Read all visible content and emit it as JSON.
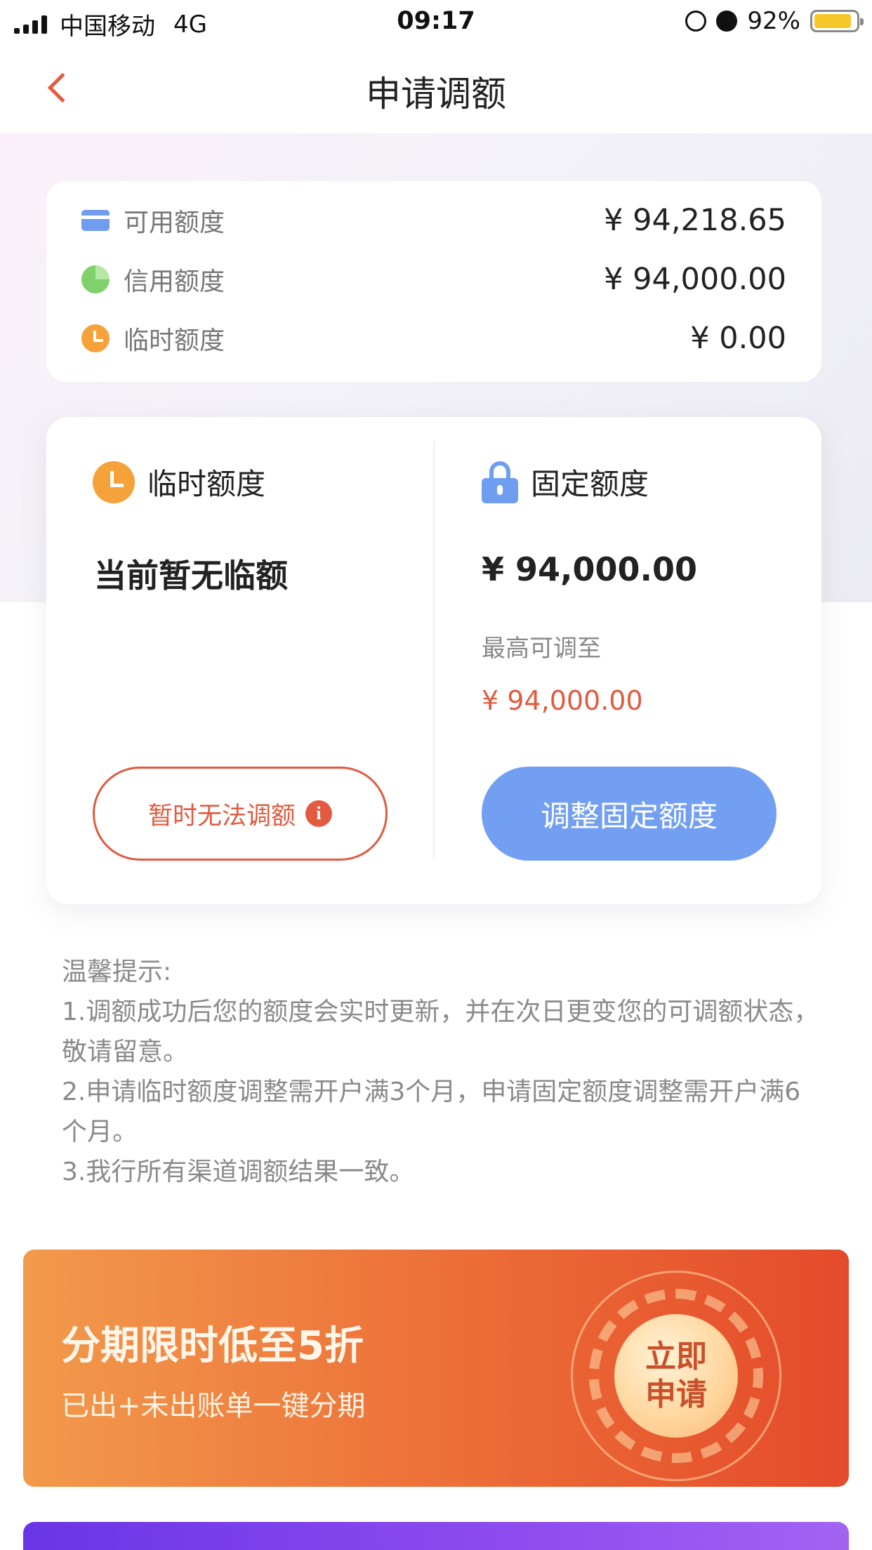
{
  "status_bar": {
    "carrier": "中国移动",
    "network": "4G",
    "time": "09:17",
    "battery": "92%"
  },
  "nav": {
    "title": "申请调额"
  },
  "summary": {
    "rows": [
      {
        "label": "可用额度",
        "value": "¥ 94,218.65",
        "icon": "card-icon"
      },
      {
        "label": "信用额度",
        "value": "¥ 94,000.00",
        "icon": "pie-icon"
      },
      {
        "label": "临时额度",
        "value": "¥ 0.00",
        "icon": "clock-icon"
      }
    ]
  },
  "temp_limit": {
    "title": "临时额度",
    "status": "当前暂无临额",
    "button_label": "暂时无法调额",
    "info_glyph": "i"
  },
  "fixed_limit": {
    "title": "固定额度",
    "value": "¥ 94,000.00",
    "max_label": "最高可调至",
    "max_value": "¥ 94,000.00",
    "button_label": "调整固定额度"
  },
  "tips": {
    "heading": "温馨提示:",
    "items": [
      "1.调额成功后您的额度会实时更新，并在次日更变您的可调额状态，敬请留意。",
      "2.申请临时额度调整需开户满3个月，申请固定额度调整需开户满6个月。",
      "3.我行所有渠道调额结果一致。"
    ]
  },
  "banner": {
    "title": "分期限时低至5折",
    "subtitle": "已出+未出账单一键分期",
    "badge_line1": "立即",
    "badge_line2": "申请"
  },
  "colors": {
    "accent_red": "#e25a3f",
    "accent_blue": "#729ff2",
    "accent_orange": "#f5a23a"
  }
}
